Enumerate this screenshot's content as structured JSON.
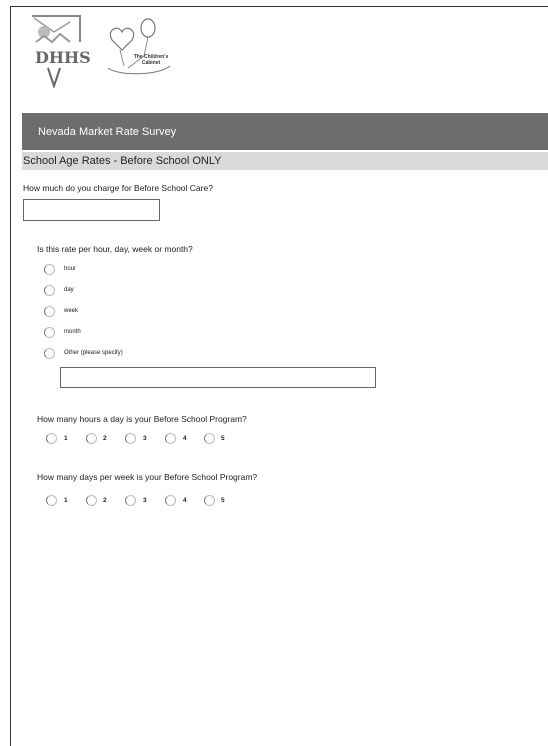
{
  "logos": {
    "dhhs_text": "DHHS",
    "cc_line1": "The Children's",
    "cc_line2": "Cabinet"
  },
  "survey": {
    "title": "Nevada Market Rate Survey",
    "page_title": "School Age Rates - Before School ONLY"
  },
  "q1": {
    "label": "How much do you charge for Before School Care?",
    "value": ""
  },
  "q2": {
    "label": "Is this rate per hour, day, week or month?",
    "options": [
      "hour",
      "day",
      "week",
      "month",
      "Other (please specify)"
    ],
    "other_value": ""
  },
  "q3": {
    "label": "How many hours a day is your Before School Program?",
    "options": [
      "1",
      "2",
      "3",
      "4",
      "5"
    ]
  },
  "q4": {
    "label": "How many days per week is your Before School Program?",
    "options": [
      "1",
      "2",
      "3",
      "4",
      "5"
    ]
  }
}
